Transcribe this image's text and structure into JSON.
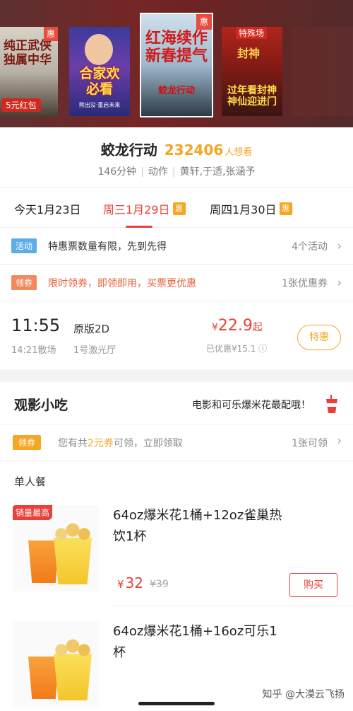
{
  "posters": [
    {
      "title_line1": "纯正武侠",
      "title_line2": "独属中华",
      "badge": "惠",
      "redpack": "5元红包"
    },
    {
      "title_line1": "合家欢",
      "title_line2": "必看",
      "sub": "熊出没·重启未来"
    },
    {
      "title_line1": "红海续作",
      "title_line2": "新春提气",
      "badge": "惠",
      "sub": "蛟龙行动"
    },
    {
      "tag": "特殊场",
      "logo": "封神",
      "title_line1": "过年看封神",
      "title_line2": "神仙迎进门"
    }
  ],
  "movie": {
    "name": "蛟龙行动",
    "want_count": "232406",
    "want_label": "人想看",
    "duration": "146分钟",
    "genre": "动作",
    "cast": "黄轩,于适,张涵予"
  },
  "dates": [
    {
      "label": "今天1月23日",
      "badge": ""
    },
    {
      "label": "周三1月29日",
      "badge": "惠"
    },
    {
      "label": "周四1月30日",
      "badge": "惠"
    }
  ],
  "activity": {
    "badge": "活动",
    "text": "特惠票数量有限，先到先得",
    "right": "4个活动",
    "chevron": "›"
  },
  "coupon_row": {
    "badge": "领券",
    "text": "限时领券，即领即用，买票更优惠",
    "right": "1张优惠券",
    "chevron": "›"
  },
  "showtime": {
    "start": "11:55",
    "end": "14:21散场",
    "version": "原版2D",
    "hall": "1号激光厅",
    "currency": "¥",
    "price": "22.9",
    "price_suffix": "起",
    "discount": "已优惠¥15.1 ⓘ",
    "button": "特惠"
  },
  "snacks": {
    "title": "观影小吃",
    "slogan": "电影和可乐爆米花最配哦！",
    "coupon": {
      "badge": "领券",
      "text_pre": "您有共",
      "text_highlight": "2元券",
      "text_post": "可领，立即领取",
      "right": "1张可领",
      "chevron": "›"
    },
    "single_label": "单人餐",
    "items": [
      {
        "name": "64oz爆米花1桶+12oz雀巢热饮1杯",
        "best_tag": "销量最高",
        "currency": "¥",
        "price": "32",
        "orig": "¥39",
        "buy": "购买"
      },
      {
        "name": "64oz爆米花1桶+16oz可乐1杯"
      }
    ]
  },
  "watermark": "知乎 @大漠云飞扬",
  "colors": {
    "primary_red": "#e8403a",
    "accent_orange": "#f5a623",
    "activity_blue": "#5aaee8"
  }
}
